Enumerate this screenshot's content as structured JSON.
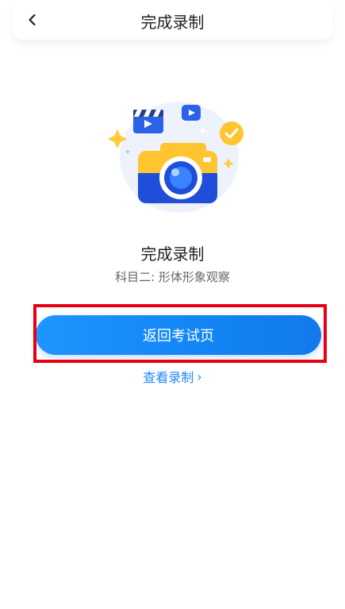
{
  "header": {
    "title": "完成录制"
  },
  "main": {
    "title": "完成录制",
    "subtitle": "科目二: 形体形象观察"
  },
  "actions": {
    "return_label": "返回考试页",
    "view_label": "查看录制",
    "view_chevron": "›"
  },
  "colors": {
    "accent": "#1e88ff",
    "button": "#1f95ff",
    "highlight": "#e60012"
  }
}
